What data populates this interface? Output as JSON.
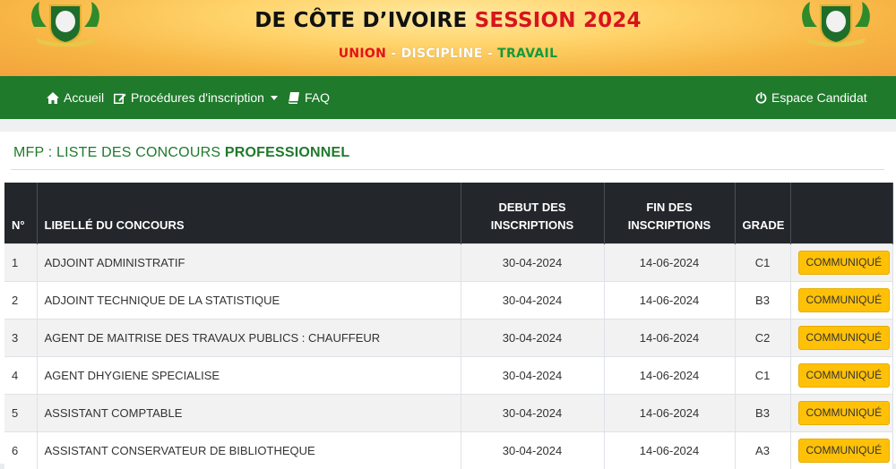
{
  "banner": {
    "title_black": "DE CÔTE D’IVOIRE",
    "title_red": "SESSION 2024",
    "motto_1": "UNION",
    "sep_1": " - ",
    "motto_2": "DISCIPLINE",
    "sep_2": " - ",
    "motto_3": "TRAVAIL"
  },
  "nav": {
    "home": "Accueil",
    "procedures": "Procédures d'inscription",
    "faq": "FAQ",
    "candidate": "Espace Candidat"
  },
  "page": {
    "heading_prefix": "MFP : LISTE DES CONCOURS ",
    "heading_bold": "PROFESSIONNEL"
  },
  "table": {
    "headers": {
      "num": "N°",
      "label": "LIBELLÉ DU CONCOURS",
      "start_1": "DEBUT DES",
      "start_2": "INSCRIPTIONS",
      "end_1": "FIN DES",
      "end_2": "INSCRIPTIONS",
      "grade": "GRADE"
    },
    "button_label": "COMMUNIQUÉ",
    "rows": [
      {
        "num": "1",
        "label": "ADJOINT ADMINISTRATIF",
        "start": "30-04-2024",
        "end": "14-06-2024",
        "grade": "C1"
      },
      {
        "num": "2",
        "label": "ADJOINT TECHNIQUE DE LA STATISTIQUE",
        "start": "30-04-2024",
        "end": "14-06-2024",
        "grade": "B3"
      },
      {
        "num": "3",
        "label": "AGENT DE MAITRISE DES TRAVAUX PUBLICS : CHAUFFEUR",
        "start": "30-04-2024",
        "end": "14-06-2024",
        "grade": "C2"
      },
      {
        "num": "4",
        "label": "AGENT DHYGIENE SPECIALISE",
        "start": "30-04-2024",
        "end": "14-06-2024",
        "grade": "C1"
      },
      {
        "num": "5",
        "label": "ASSISTANT COMPTABLE",
        "start": "30-04-2024",
        "end": "14-06-2024",
        "grade": "B3"
      },
      {
        "num": "6",
        "label": "ASSISTANT CONSERVATEUR DE BIBLIOTHEQUE",
        "start": "30-04-2024",
        "end": "14-06-2024",
        "grade": "A3"
      }
    ]
  },
  "colors": {
    "nav_green": "#1f7a2b",
    "header_dark": "#23272b",
    "button_yellow": "#ffc107",
    "title_red": "#d8141d"
  }
}
